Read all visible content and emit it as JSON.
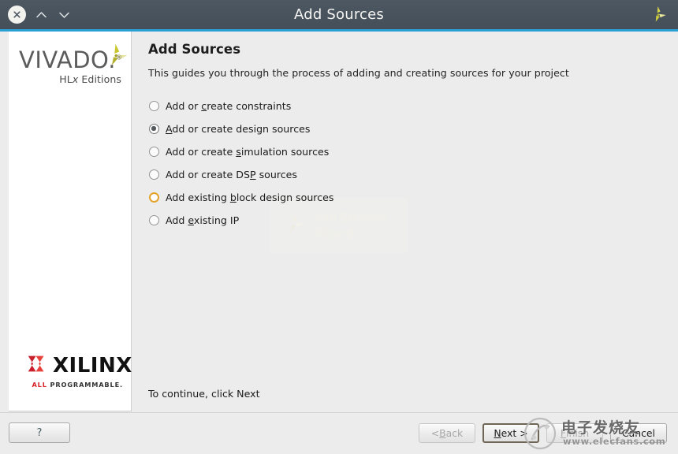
{
  "window": {
    "title": "Add Sources",
    "close_icon": "close-circle-icon",
    "collapse_icon": "chevron-up-icon",
    "expand_icon": "chevron-down-icon",
    "brand_icon": "xilinx-pinwheel-icon"
  },
  "sidebar": {
    "product_name": "VIVADO",
    "product_dot": ".",
    "product_tm": "®",
    "product_edition_pre": "HL",
    "product_edition_x": "x",
    "product_edition_post": " Editions",
    "pinwheel_icon": "xilinx-pinwheel-icon",
    "vendor_name": "XILINX",
    "vendor_mark_icon": "xilinx-x-mark-icon",
    "vendor_tagline_accent": "ALL",
    "vendor_tagline_rest": " PROGRAMMABLE."
  },
  "main": {
    "title": "Add Sources",
    "description": "This guides you through the process of adding and creating sources for your project",
    "continue_note": "To continue, click Next",
    "ghost_watermark": {
      "line1": "Add Sources",
      "line2": "Wizard",
      "icon": "xilinx-pinwheel-icon"
    },
    "options": [
      {
        "id": "add-or-create-constraints",
        "pre": "Add or ",
        "accel": "c",
        "post": "reate constraints",
        "state": "normal"
      },
      {
        "id": "add-or-create-design-sources",
        "pre": "",
        "accel": "A",
        "post": "dd or create design sources",
        "state": "selected"
      },
      {
        "id": "add-or-create-simulation-sources",
        "pre": "Add or create ",
        "accel": "s",
        "post": "imulation sources",
        "state": "normal"
      },
      {
        "id": "add-or-create-dsp-sources",
        "pre": "Add or create DS",
        "accel": "P",
        "post": " sources",
        "state": "normal"
      },
      {
        "id": "add-existing-block-design-sources",
        "pre": "Add existing ",
        "accel": "b",
        "post": "lock design sources",
        "state": "hovered"
      },
      {
        "id": "add-existing-ip",
        "pre": "Add ",
        "accel": "e",
        "post": "xisting IP",
        "state": "normal"
      }
    ]
  },
  "footer": {
    "help_label": "?",
    "back": {
      "pre": "< ",
      "accel": "B",
      "post": "ack",
      "enabled": false
    },
    "next": {
      "pre": "",
      "accel": "N",
      "post": "ext >",
      "enabled": true,
      "focused": true
    },
    "finish": {
      "pre": "",
      "accel": "F",
      "post": "inish",
      "enabled": false
    },
    "cancel": {
      "pre": "",
      "accel": "",
      "post": "Cancel",
      "enabled": true
    }
  },
  "watermark": {
    "text_cn": "电子发烧友",
    "text_url": "www.elecfans.com",
    "icon": "elecfans-logo-icon"
  },
  "colors": {
    "titlebar": "#4a545e",
    "accent_line": "#2a9fd6",
    "panel": "#ececec",
    "sidebar": "#ffffff",
    "brand_yellow": "#c8c22a",
    "brand_red": "#d7242b",
    "hover_ring": "#e3a32a"
  }
}
